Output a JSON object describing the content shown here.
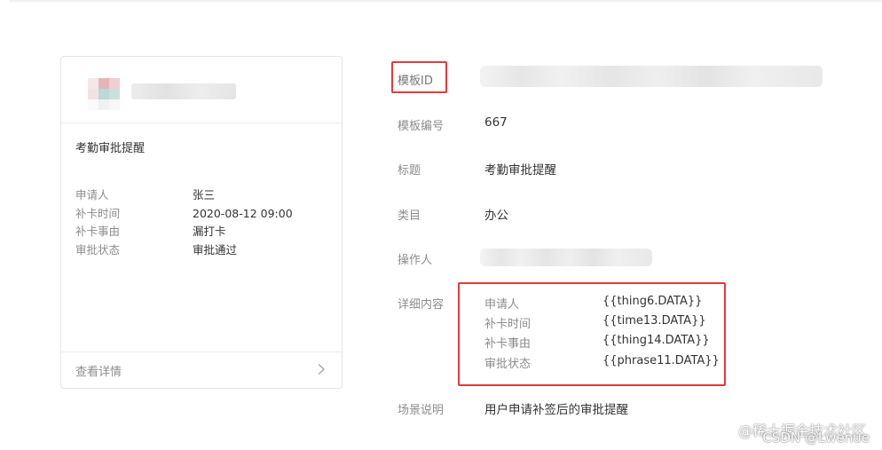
{
  "preview": {
    "title": "考勤审批提醒",
    "fields": [
      {
        "label": "申请人",
        "value": "张三"
      },
      {
        "label": "补卡时间",
        "value": "2020-08-12 09:00"
      },
      {
        "label": "补卡事由",
        "value": "漏打卡"
      },
      {
        "label": "审批状态",
        "value": "审批通过"
      }
    ],
    "detail_link": "查看详情"
  },
  "info": {
    "template_id_label": "模板ID",
    "template_no_label": "模板编号",
    "template_no": "667",
    "title_label": "标题",
    "title": "考勤审批提醒",
    "category_label": "类目",
    "category": "办公",
    "operator_label": "操作人",
    "detail_label": "详细内容",
    "detail": [
      {
        "label": "申请人",
        "value": "{{thing6.DATA}}"
      },
      {
        "label": "补卡时间",
        "value": "{{time13.DATA}}"
      },
      {
        "label": "补卡事由",
        "value": "{{thing14.DATA}}"
      },
      {
        "label": "审批状态",
        "value": "{{phrase11.DATA}}"
      }
    ],
    "scene_label": "场景说明",
    "scene": "用户申请补签后的审批提醒"
  },
  "watermark": {
    "line1": "@稀土掘金技术社区",
    "line2": "CSDN @Lwenue"
  },
  "colors": {
    "highlight": "#e33b3b",
    "label": "#8c8c8c",
    "text": "#333333"
  }
}
